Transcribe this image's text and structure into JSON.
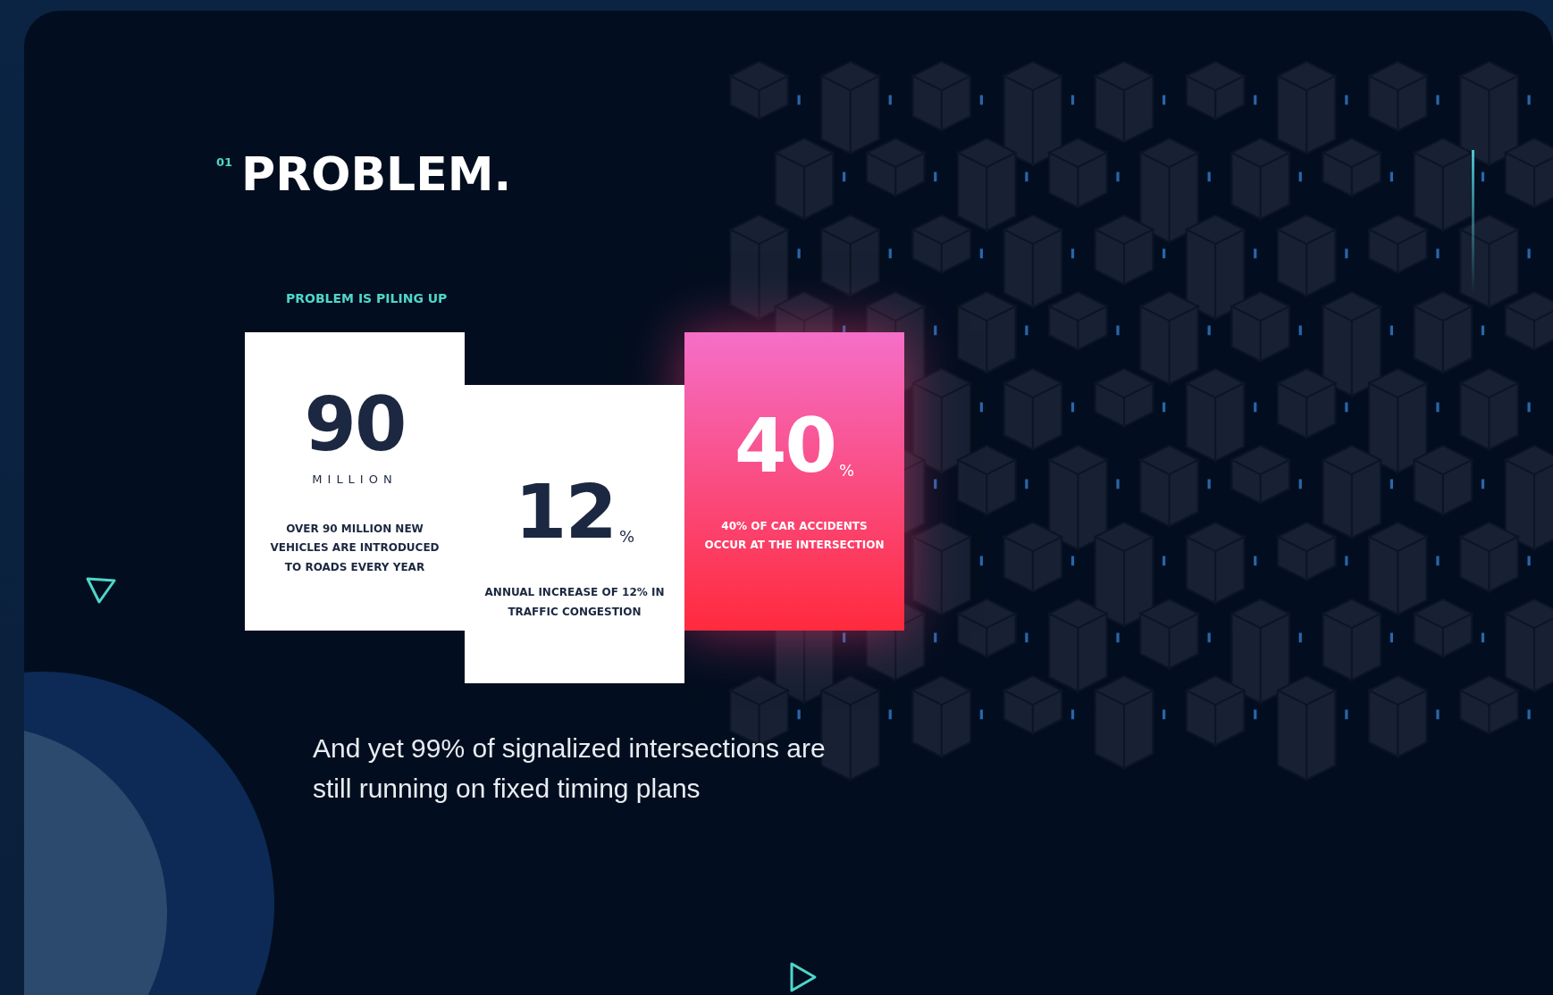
{
  "section": {
    "number": "01",
    "title": "PROBLEM.",
    "subtitle": "PROBLEM IS PILING UP"
  },
  "cards": [
    {
      "kind": "million",
      "value": "90",
      "unit": "MILLION",
      "text": "OVER 90 MILLION NEW VEHICLES ARE INTRODUCED TO ROADS EVERY YEAR"
    },
    {
      "kind": "percent",
      "value": "12",
      "unit": "%",
      "text": "ANNUAL INCREASE OF 12% IN TRAFFIC CONGESTION"
    },
    {
      "kind": "highlight",
      "value": "40",
      "unit": "%",
      "text": "40% OF CAR ACCIDENTS OCCUR AT THE INTERSECTION"
    }
  ],
  "statement": "And yet 99% of signalized intersections are still running on fixed timing plans"
}
